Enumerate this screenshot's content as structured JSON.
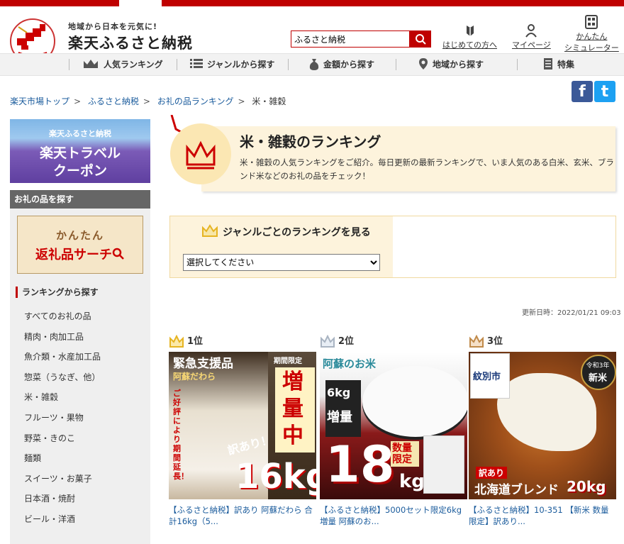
{
  "header": {
    "tagline": "地域から日本を元気に!",
    "site_name": "楽天ふるさと納税",
    "search_value": "ふるさと納税",
    "links": [
      {
        "label": "はじめての方へ"
      },
      {
        "label": "マイページ"
      },
      {
        "label1": "かんたん",
        "label2": "シミュレーター"
      }
    ]
  },
  "nav": {
    "items": [
      "人気ランキング",
      "ジャンルから探す",
      "金額から探す",
      "地域から探す",
      "特集"
    ]
  },
  "breadcrumb": [
    "楽天市場トップ",
    "ふるさと納税",
    "お礼の品ランキング",
    "米・雑穀"
  ],
  "social": {
    "facebook": "f",
    "twitter": "t"
  },
  "sidebar": {
    "travel": {
      "line1": "楽天ふるさと納税",
      "line2": "楽天トラベル",
      "line3": "クーポン"
    },
    "section_title": "お礼の品を探す",
    "search_banner": {
      "line1": "かんたん",
      "line2": "返礼品サーチ"
    },
    "ranking_title": "ランキングから探す",
    "categories": [
      "すべてのお礼の品",
      "精肉・肉加工品",
      "魚介類・水産加工品",
      "惣菜（うなぎ、他）",
      "米・雑穀",
      "フルーツ・果物",
      "野菜・きのこ",
      "麺類",
      "スイーツ・お菓子",
      "日本酒・焼酎",
      "ビール・洋酒"
    ]
  },
  "banner": {
    "title": "米・雑穀のランキング",
    "description": "米・雑穀の人気ランキングをご紹介。毎日更新の最新ランキングで、いま人気のある白米、玄米、ブランド米などのお礼の品をチェック！"
  },
  "genre": {
    "title": "ジャンルごとのランキングを見る",
    "select_value": "選択してください"
  },
  "updated": "更新日時：2022/01/21 09:03",
  "colors": {
    "accent": "#bf0000",
    "gold": "#e6b422",
    "silver": "#a9b4c2",
    "bronze": "#c08a4a",
    "link": "#1a5b9c"
  },
  "ranking": [
    {
      "rank": "1位",
      "caption": "【ふるさと納税】訳あり 阿蘇だわら 合計16kg（5...",
      "img": {
        "tag": "緊急支援品",
        "brand": "阿蘇だわら",
        "limited": "期間限定",
        "big": "増量中",
        "side": "ご好評により期間延長！",
        "weight": "16kg",
        "wake": "訳あり！"
      }
    },
    {
      "rank": "2位",
      "caption": "【ふるさと納税】5000セット限定6kg増量 阿蘇のお...",
      "img": {
        "brand": "阿蘇のお米",
        "plus": "6kg",
        "plus2": "増量",
        "big": "18",
        "unit": "kg",
        "limited": "数量限定"
      }
    },
    {
      "rank": "3位",
      "caption": "【ふるさと納税】10-351 【新米 数量限定】訳あり...",
      "img": {
        "city": "紋別市",
        "era": "令和3年",
        "new": "新米",
        "wake": "訳あり",
        "blend": "北海道ブレンド",
        "weight": "20kg"
      }
    }
  ]
}
